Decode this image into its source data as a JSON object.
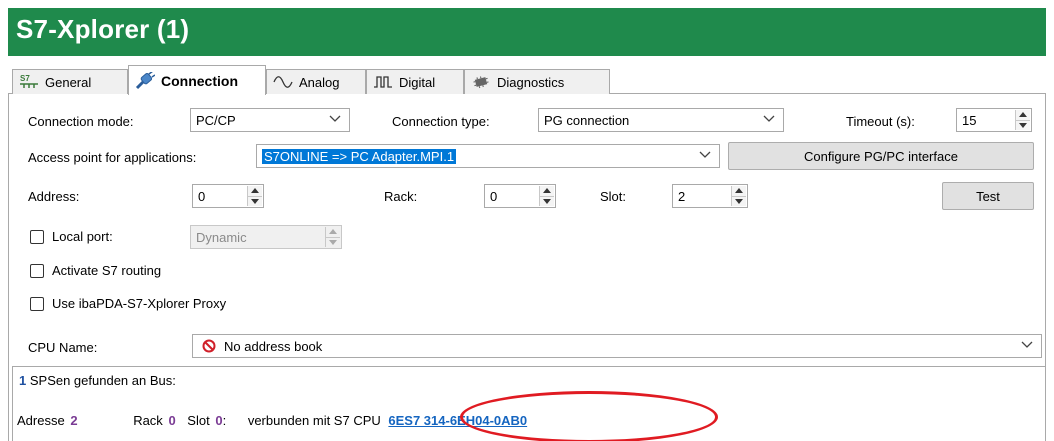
{
  "window": {
    "title": "S7-Xplorer (1)"
  },
  "tabs": [
    {
      "label": "General",
      "icon": "s7-icon"
    },
    {
      "label": "Connection",
      "icon": "plug-icon",
      "active": true
    },
    {
      "label": "Analog",
      "icon": "wave-icon"
    },
    {
      "label": "Digital",
      "icon": "square-wave-icon"
    },
    {
      "label": "Diagnostics",
      "icon": "chip-icon"
    }
  ],
  "connection": {
    "mode_label": "Connection mode:",
    "mode_value": "PC/CP",
    "type_label": "Connection type:",
    "type_value": "PG connection",
    "timeout_label": "Timeout (s):",
    "timeout_value": "15",
    "access_label": "Access point for applications:",
    "access_value": "S7ONLINE => PC Adapter.MPI.1",
    "configure_button": "Configure PG/PC interface",
    "address_label": "Address:",
    "address_value": "0",
    "rack_label": "Rack:",
    "rack_value": "0",
    "slot_label": "Slot:",
    "slot_value": "2",
    "test_button": "Test",
    "local_port_label": "Local port:",
    "local_port_value": "Dynamic",
    "routing_label": "Activate S7 routing",
    "proxy_label": "Use ibaPDA-S7-Xplorer Proxy",
    "cpu_name_label": "CPU Name:",
    "cpu_name_value": "No address book"
  },
  "result": {
    "count": "1",
    "header_text": " SPSen gefunden an Bus:",
    "adresse_label": "Adresse",
    "adresse_value": "2",
    "rack_label": "Rack",
    "rack_value": "0",
    "slot_label": "Slot",
    "slot_value": "0",
    "slot_colon": ":",
    "connected_text": "verbunden mit S7 CPU",
    "cpu_order_number": "6ES7 314-6EH04-0AB0"
  },
  "colors": {
    "titlebar": "#1f8a4c",
    "highlight": "#e01b22",
    "link": "#1565c0"
  }
}
